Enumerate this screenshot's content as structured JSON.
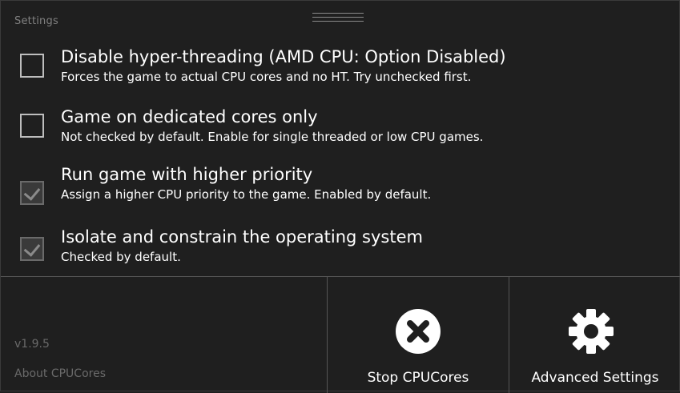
{
  "window": {
    "section_label": "Settings"
  },
  "options": [
    {
      "title": "Disable hyper-threading (AMD CPU: Option Disabled)",
      "description": "Forces the game to actual CPU cores and no HT. Try unchecked first.",
      "checked": false
    },
    {
      "title": "Game on dedicated cores only",
      "description": "Not checked by default. Enable for single threaded or low CPU games.",
      "checked": false
    },
    {
      "title": "Run game with higher priority",
      "description": "Assign a higher CPU priority to the game. Enabled by default.",
      "checked": true
    },
    {
      "title": "Isolate and constrain the operating system",
      "description": "Checked by default.",
      "checked": true
    }
  ],
  "footer": {
    "version": "v1.9.5",
    "about_link": "About CPUCores"
  },
  "actions": {
    "stop_label": "Stop CPUCores",
    "stop_icon": "close-circle-icon",
    "advanced_label": "Advanced Settings",
    "advanced_icon": "gear-icon"
  }
}
